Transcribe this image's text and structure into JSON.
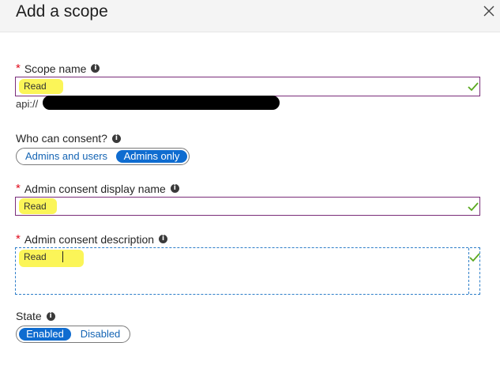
{
  "header": {
    "title": "Add a scope",
    "close_icon": "close-icon"
  },
  "scope_name": {
    "label": "Scope name",
    "required_marker": "*",
    "value": "Read",
    "api_prefix": "api://"
  },
  "who_can_consent": {
    "label": "Who can consent?",
    "options": [
      "Admins and users",
      "Admins only"
    ],
    "selected": "Admins only"
  },
  "admin_display_name": {
    "label": "Admin consent display name",
    "required_marker": "*",
    "value": "Read"
  },
  "admin_description": {
    "label": "Admin consent description",
    "required_marker": "*",
    "value": "Read"
  },
  "state": {
    "label": "State",
    "options": [
      "Enabled",
      "Disabled"
    ],
    "selected": "Enabled"
  },
  "colors": {
    "header_bg": "#f4f4f4",
    "field_border": "#7a2d79",
    "focus_border": "#2d7ec9",
    "valid_check": "#5aa81f",
    "toggle_selected": "#0f6cd0",
    "highlight": "#faf33b",
    "required": "#e00b1c"
  }
}
